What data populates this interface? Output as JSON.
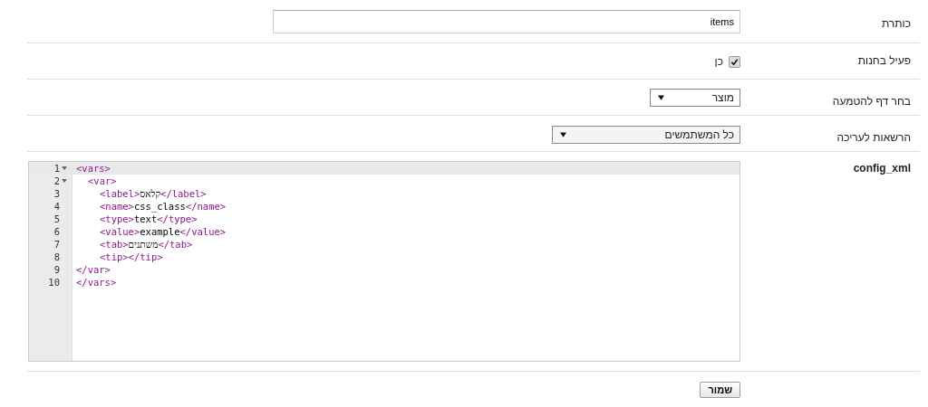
{
  "fields": [
    {
      "kind": "text",
      "label": "כותרת",
      "value": "items"
    },
    {
      "kind": "checkbox",
      "label": "פעיל בחנות",
      "checked": true,
      "option": "כן"
    },
    {
      "kind": "select",
      "label": "בחר דף להטמעה",
      "value": "מוצר"
    },
    {
      "kind": "select-wide",
      "label": "הרשאות לעריכה",
      "value": "כל המשתמשים"
    }
  ],
  "config": {
    "label": "config_xml",
    "lines": [
      {
        "number": "1",
        "foldable": true,
        "active": true,
        "text": "<vars>",
        "children": [
          {
            "number": "2",
            "foldable": true,
            "active": false,
            "text": "<var>",
            "children": [
              {
                "number": "3",
                "foldable": false,
                "active": false,
                "text": "<label>קלאס</label>"
              },
              {
                "number": "4",
                "foldable": false,
                "active": false,
                "text": "<name>css_class</name>"
              },
              {
                "number": "5",
                "foldable": false,
                "active": false,
                "text": "<type>text</type>"
              },
              {
                "number": "6",
                "foldable": false,
                "active": false,
                "text": "<value>example</value>"
              },
              {
                "number": "7",
                "foldable": false,
                "active": false,
                "text": "<tab>משתנים</tab>"
              },
              {
                "number": "8",
                "foldable": false,
                "active": false,
                "text": "<tip></tip>"
              }
            ]
          }
        ]
      },
      {
        "number": "9",
        "foldable": false,
        "active": false,
        "text": "</var>"
      },
      {
        "number": "10",
        "foldable": false,
        "active": false,
        "text": "</vars>"
      }
    ]
  },
  "save_button": "שמור"
}
